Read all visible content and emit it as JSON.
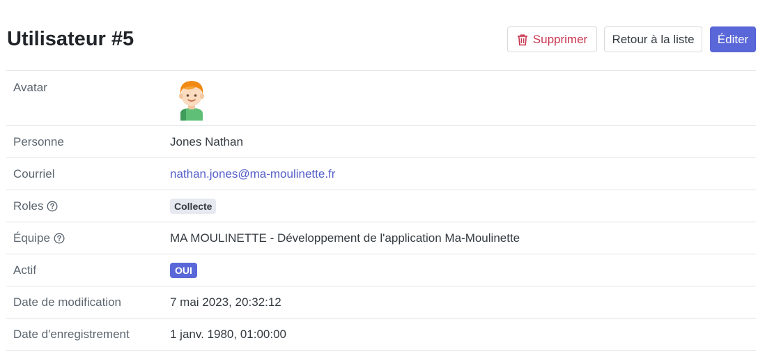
{
  "page": {
    "title": "Utilisateur #5"
  },
  "actions": {
    "delete_label": "Supprimer",
    "back_label": "Retour à la liste",
    "edit_label": "Éditer"
  },
  "fields": {
    "avatar": {
      "label": "Avatar",
      "icon": "boy-avatar-icon"
    },
    "person": {
      "label": "Personne",
      "value": "Jones Nathan"
    },
    "email": {
      "label": "Courriel",
      "value": "nathan.jones@ma-moulinette.fr"
    },
    "roles": {
      "label": "Roles",
      "value": "Collecte"
    },
    "team": {
      "label": "Équipe",
      "value": "MA MOULINETTE - Développement de l'application Ma-Moulinette"
    },
    "active": {
      "label": "Actif",
      "value": "OUI"
    },
    "modified": {
      "label": "Date de modification",
      "value": "7 mai 2023, 20:32:12"
    },
    "registered": {
      "label": "Date d'enregistrement",
      "value": "1 janv. 1980, 01:00:00"
    }
  },
  "colors": {
    "primary": "#5a67d8",
    "danger": "#c7364f",
    "link": "#5560c9",
    "border": "#dee2e6"
  }
}
